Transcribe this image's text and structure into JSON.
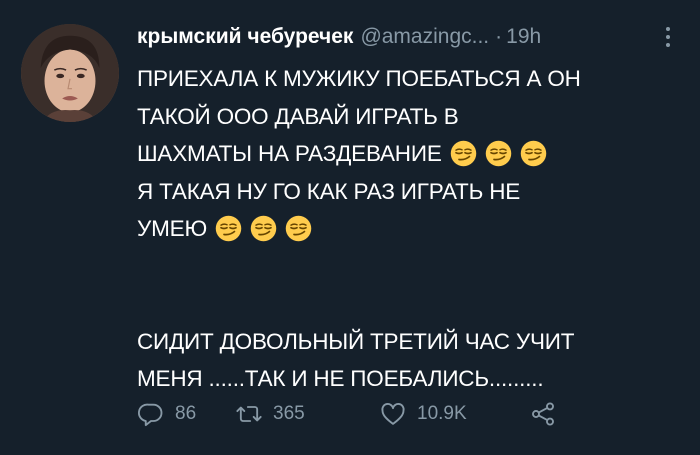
{
  "tweet": {
    "author_name": "крымский чебуречек",
    "handle": "@amazingc...",
    "separator": "·",
    "time": "19h",
    "text_lines": [
      {
        "text": "ПРИЕХАЛА К МУЖИКУ ПОЕБАТЬСЯ А ОН",
        "emoji_count": 0
      },
      {
        "text": "ТАКОЙ ООО ДАВАЙ ИГРАТЬ В",
        "emoji_count": 0
      },
      {
        "text": "ШАХМАТЫ НА РАЗДЕВАНИЕ",
        "emoji_count": 3
      },
      {
        "text": "Я ТАКАЯ НУ ГО КАК РАЗ ИГРАТЬ НЕ",
        "emoji_count": 0
      },
      {
        "text": "УМЕЮ",
        "emoji_count": 3
      },
      {
        "text": "",
        "emoji_count": 0
      },
      {
        "text": "СИДИТ ДОВОЛЬНЫЙ ТРЕТИЙ ЧАС УЧИТ",
        "emoji_count": 0
      },
      {
        "text": "МЕНЯ ......ТАК И НЕ ПОЕБАЛИСЬ.........",
        "emoji_count": 0
      }
    ],
    "emoji_icon": "smirking-face-emoji",
    "actions": {
      "reply_count": "86",
      "retweet_count": "365",
      "like_count": "10.9K"
    }
  },
  "icons": {
    "reply": "reply-icon",
    "retweet": "retweet-icon",
    "like": "heart-icon",
    "share": "share-icon",
    "more": "more-icon"
  },
  "colors": {
    "background": "#15202b",
    "text": "#ffffff",
    "secondary": "#8899a6",
    "emoji": "#ffcc4d"
  }
}
